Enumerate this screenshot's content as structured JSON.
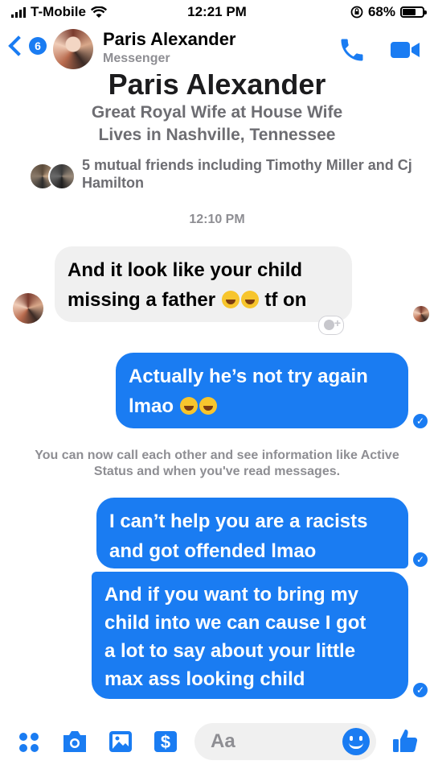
{
  "status_bar": {
    "carrier": "T-Mobile",
    "time": "12:21 PM",
    "battery": "68%",
    "battery_level": 0.68
  },
  "header": {
    "back_badge": "6",
    "contact_name": "Paris Alexander",
    "subtitle": "Messenger"
  },
  "profile": {
    "name": "Paris Alexander",
    "work": "Great Royal Wife at House Wife",
    "location": "Lives in Nashville, Tennessee",
    "mutual_friends": "5 mutual friends including Timothy Miller and Cj Hamilton"
  },
  "conversation": {
    "timestamp": "12:10 PM",
    "msg1": {
      "line1": "And it look like your child",
      "line2_a": "missing a father",
      "line2_b": "tf on"
    },
    "msg2": {
      "line1": "Actually he’s not try again",
      "line2": "lmao"
    },
    "notice": "You can now call each other and see information like Active Status and when you've read messages.",
    "msg3": {
      "line1": "I can’t help you are a racists",
      "line2": "and got offended lmao"
    },
    "msg4": {
      "line1": "And if you want to bring my",
      "line2": "child into we can cause I got",
      "line3": "a lot to say about your little",
      "line4": "max ass looking child"
    }
  },
  "composer": {
    "placeholder": "Aa"
  },
  "colors": {
    "accent": "#1a7cf2",
    "incoming_bubble": "#f0f0f0",
    "secondary_text": "#8e8e93"
  },
  "icons": [
    "wifi-icon",
    "phone-icon",
    "video-icon",
    "apps-icon",
    "camera-icon",
    "gallery-icon",
    "dollar-icon",
    "smile-icon",
    "thumbs-up-icon"
  ]
}
